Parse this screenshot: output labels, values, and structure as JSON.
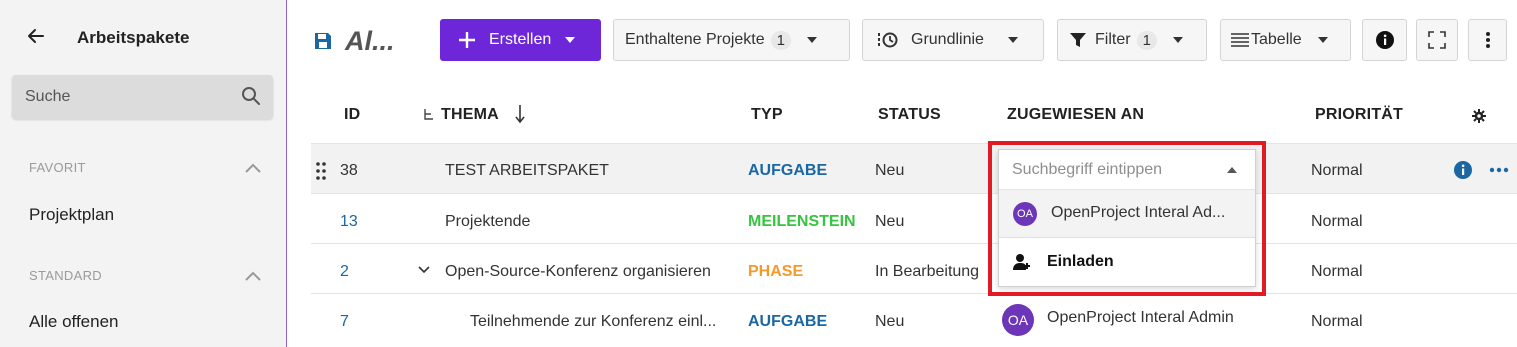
{
  "sidebar": {
    "title": "Arbeitspakete",
    "search_placeholder": "Suche",
    "sections": [
      {
        "label": "FAVORIT",
        "items": [
          "Projektplan"
        ]
      },
      {
        "label": "STANDARD",
        "items": [
          "Alle offenen"
        ]
      }
    ]
  },
  "toolbar": {
    "title": "Al...",
    "create_label": "Erstellen",
    "projects_label": "Enthaltene Projekte",
    "projects_count": "1",
    "baseline_label": "Grundlinie",
    "filter_label": "Filter",
    "filter_count": "1",
    "view_label": "Tabelle"
  },
  "table": {
    "headers": {
      "id": "ID",
      "thema": "THEMA",
      "typ": "TYP",
      "status": "STATUS",
      "assignee": "ZUGEWIESEN AN",
      "priority": "PRIORITÄT"
    },
    "rows": [
      {
        "id": "38",
        "thema": "TEST ARBEITSPAKET",
        "typ": "AUFGABE",
        "status": "Neu",
        "assignee": "",
        "priority": "Normal"
      },
      {
        "id": "13",
        "thema": "Projektende",
        "typ": "MEILENSTEIN",
        "status": "Neu",
        "assignee": "",
        "priority": "Normal"
      },
      {
        "id": "2",
        "thema": "Open-Source-Konferenz organisieren",
        "typ": "PHASE",
        "status": "In Bearbeitung",
        "assignee": "",
        "priority": "Normal"
      },
      {
        "id": "7",
        "thema": "Teilnehmende zur Konferenz einl...",
        "typ": "AUFGABE",
        "status": "Neu",
        "assignee": "OpenProject Interal Admin",
        "assignee_initials": "OA",
        "priority": "Normal"
      }
    ]
  },
  "dropdown": {
    "placeholder": "Suchbegriff eintippen",
    "option_initials": "OA",
    "option_label": "OpenProject Interal Ad...",
    "invite_label": "Einladen"
  },
  "colors": {
    "accent": "#6d27d9",
    "highlight": "#e01b24",
    "link": "#1a67a3"
  }
}
